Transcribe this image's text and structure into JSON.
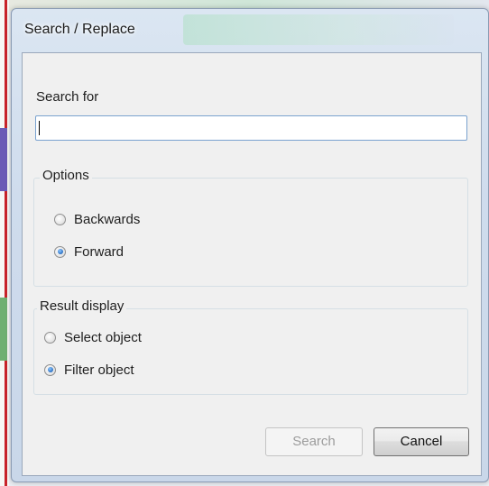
{
  "window": {
    "title": "Search / Replace"
  },
  "search": {
    "label": "Search for",
    "value": ""
  },
  "options": {
    "title": "Options",
    "items": [
      {
        "label": "Backwards",
        "checked": false
      },
      {
        "label": "Forward",
        "checked": true
      }
    ]
  },
  "result_display": {
    "title": "Result display",
    "items": [
      {
        "label": "Select object",
        "checked": false
      },
      {
        "label": "Filter object",
        "checked": true
      }
    ]
  },
  "buttons": {
    "search_label": "Search",
    "search_enabled": false,
    "cancel_label": "Cancel"
  },
  "colors": {
    "selected_radio": "#2b6fc2",
    "dialog_frame": "#cfdced",
    "client_background": "#f0f0f0"
  }
}
